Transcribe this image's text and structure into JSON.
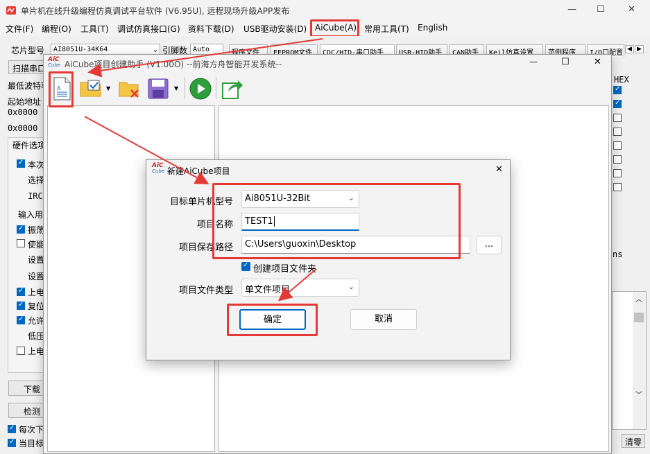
{
  "main_window": {
    "title": "单片机在线升级编程仿真调试平台软件 (V6.95U), 远程现场升级APP发布",
    "menu": [
      "文件(F)",
      "编程(O)",
      "工具(T)",
      "调试仿真接口(G)",
      "资料下载(D)",
      "USB驱动安装(D)",
      "AiCube(A)",
      "常用工具(T)",
      "English"
    ],
    "chip_label": "芯片型号",
    "chip_value": "AI8051U-34K64",
    "pin_label": "引脚数",
    "pin_value": "Auto",
    "tabs": [
      "程序文件",
      "EEPROM文件",
      "CDC/HID-串口助手",
      "USB-HID助手",
      "CAN助手",
      "Keil仿真设置",
      "范例程序",
      "I/O口配置"
    ],
    "scan_button": "扫描串口",
    "min_baud_label": "最低波特率",
    "start_addr_label": "起始地址",
    "addr1": "0x0000",
    "addr2": "0x0000",
    "hw_options_label": "硬件选项",
    "option_rows": [
      "本次",
      "选择",
      "IRC",
      "输入用",
      "振荡",
      "使能",
      "设置",
      "设置",
      "上电",
      "复位",
      "允许",
      "低压",
      "上电"
    ],
    "download_button": "下载",
    "check_button": "检测",
    "bottom_opt1": "每次下",
    "bottom_opt2": "当目标",
    "clear_button": "清零",
    "hex_label": "HEX",
    "ns_label": "ns"
  },
  "aicube_window": {
    "title": "AiCube项目创建助手 (V1.00O) --前海方舟智能开发系统--",
    "logo_top": "AiC",
    "logo_bottom": "Cube"
  },
  "dialog": {
    "title": "新建AiCube项目",
    "target_label": "目标单片机型号",
    "target_value": "Ai8051U-32Bit",
    "name_label": "项目名称",
    "name_value": "TEST1",
    "path_label": "项目保存路径",
    "path_value": "C:\\Users\\guoxin\\Desktop",
    "browse_label": "...",
    "create_folder_label": "创建项目文件夹",
    "filetype_label": "项目文件类型",
    "filetype_value": "单文件项目",
    "ok_label": "确定",
    "cancel_label": "取消"
  }
}
